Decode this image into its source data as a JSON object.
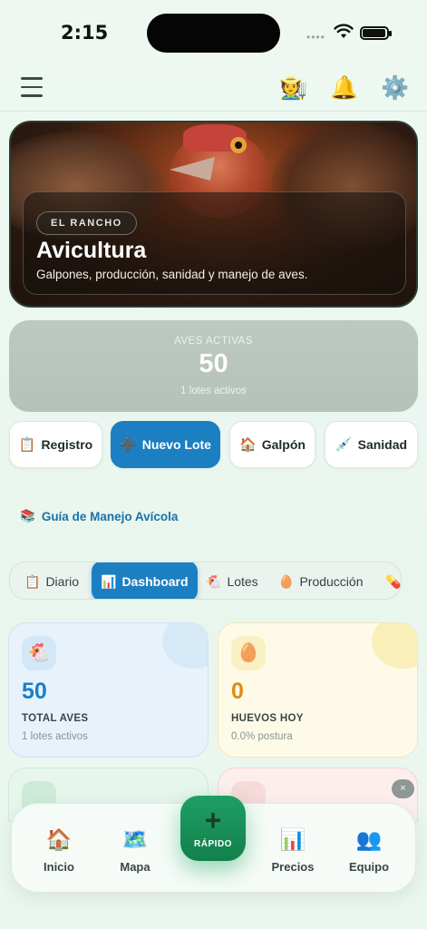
{
  "status_bar": {
    "time": "2:15",
    "dots": "••••"
  },
  "topbar": {
    "menu_icon": "hamburger-menu-icon",
    "icons": [
      "farmer-icon",
      "bell-icon",
      "gear-icon"
    ],
    "farmer_glyph": "🧑‍🌾",
    "bell_glyph": "🔔",
    "gear_glyph": "⚙️"
  },
  "hero": {
    "tag": "EL RANCHO",
    "title": "Avicultura",
    "subtitle": "Galpones, producción, sanidad y manejo de aves."
  },
  "stats": {
    "label": "AVES ACTIVAS",
    "value": "50",
    "sub": "1 lotes activos"
  },
  "actions": [
    {
      "icon": "📋",
      "label": "Registro"
    },
    {
      "icon": "➕",
      "label": "Nuevo Lote"
    },
    {
      "icon": "🏠",
      "label": "Galpón"
    },
    {
      "icon": "💉",
      "label": "Sanidad"
    }
  ],
  "guide": {
    "icon": "📚",
    "label": "Guía de Manejo Avícola"
  },
  "tabs": [
    {
      "icon": "📋",
      "label": "Diario"
    },
    {
      "icon": "📊",
      "label": "Dashboard"
    },
    {
      "icon": "🐔",
      "label": "Lotes"
    },
    {
      "icon": "🥚",
      "label": "Producción"
    },
    {
      "icon": "💊",
      "label": ""
    }
  ],
  "cards": [
    {
      "icon": "🐔",
      "value": "50",
      "label": "TOTAL AVES",
      "sub": "1 lotes activos",
      "color": "#1b7fc2"
    },
    {
      "icon": "🥚",
      "value": "0",
      "label": "HUEVOS HOY",
      "sub": "0.0% postura",
      "color": "#e08a12"
    }
  ],
  "close_label": "×",
  "nav": [
    {
      "icon": "🏠",
      "label": "Inicio"
    },
    {
      "icon": "🗺️",
      "label": "Mapa"
    },
    {
      "icon": "📊",
      "label": "Precios"
    },
    {
      "icon": "👥",
      "label": "Equipo"
    }
  ],
  "fab": {
    "icon": "+",
    "label": "RÁPIDO"
  }
}
